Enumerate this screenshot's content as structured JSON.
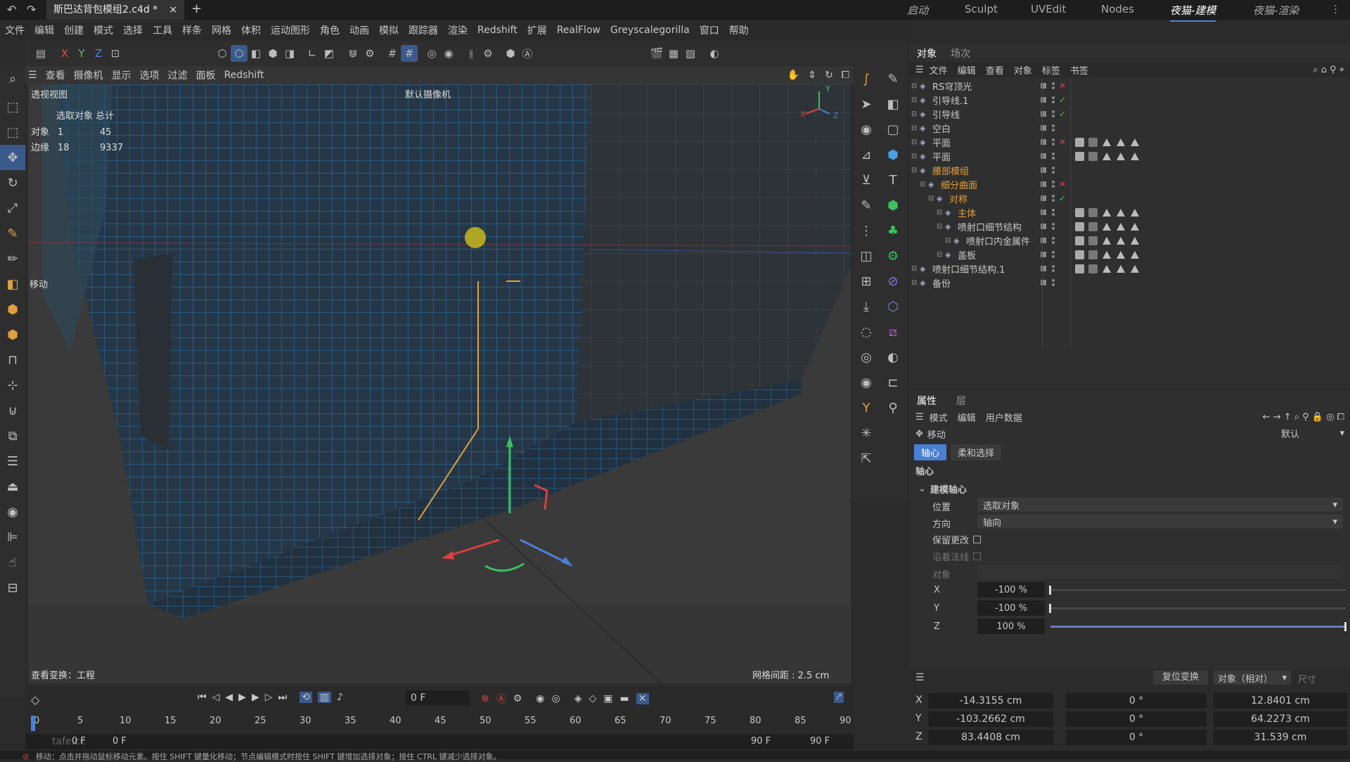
{
  "titlebar": {
    "file_tab": "斯巴达背包模组2.c4d *",
    "add_tab": "+"
  },
  "layouts": [
    "启动",
    "Sculpt",
    "UVEdit",
    "Nodes",
    "夜猫-建模",
    "夜猫-渲染"
  ],
  "menu": [
    "文件",
    "编辑",
    "创建",
    "模式",
    "选择",
    "工具",
    "样条",
    "网格",
    "体积",
    "运动图形",
    "角色",
    "动画",
    "模拟",
    "跟踪器",
    "渲染",
    "Redshift",
    "扩展",
    "RealFlow",
    "Greyscalegorilla",
    "窗口",
    "帮助"
  ],
  "toolbar_axes": [
    "X",
    "Y",
    "Z"
  ],
  "viewport": {
    "menu": [
      "查看",
      "摄像机",
      "显示",
      "选项",
      "过滤",
      "面板",
      "Redshift"
    ],
    "view_name": "透视视图",
    "camera": "默认摄像机",
    "hud_header": "选取对象 总计",
    "hud_rows": [
      {
        "label": "对象",
        "a": "1",
        "b": "45"
      },
      {
        "label": "边缘",
        "a": "18",
        "b": "9337"
      }
    ],
    "move_label": "移动",
    "view_transform": "查看变换：工程",
    "grid_spacing": "网格间距 : 2.5 cm",
    "axis_labels": {
      "y": "Y",
      "x": "X",
      "z": "Z"
    }
  },
  "timeline": {
    "current": "0 F",
    "ticks": [
      "0",
      "5",
      "10",
      "15",
      "20",
      "25",
      "30",
      "35",
      "40",
      "45",
      "50",
      "55",
      "60",
      "65",
      "70",
      "75",
      "80",
      "85",
      "90"
    ],
    "start": "0 F",
    "start2": "0 F",
    "end": "90 F",
    "end2": "90 F",
    "logo": "tafe.cc"
  },
  "status": "移动：点击并拖动鼠标移动元素。按住 SHIFT 键量化移动；节点编辑模式时按住 SHIFT 键增加选择对象；按住 CTRL 键减少选择对象。",
  "object_panel": {
    "tabs": [
      "对象",
      "场次"
    ],
    "menu": [
      "文件",
      "编辑",
      "查看",
      "对象",
      "标签",
      "书签"
    ],
    "rows": [
      {
        "name": "RS穹顶光",
        "indent": 0,
        "status": "x",
        "color": "#c8c8c8"
      },
      {
        "name": "引导线.1",
        "indent": 0,
        "status": "check",
        "color": "#c8c8c8"
      },
      {
        "name": "引导线",
        "indent": 0,
        "status": "check",
        "color": "#c8c8c8"
      },
      {
        "name": "空白",
        "indent": 0,
        "status": "",
        "color": "#c8c8c8"
      },
      {
        "name": "平面",
        "indent": 0,
        "status": "x",
        "color": "#c8c8c8"
      },
      {
        "name": "平面",
        "indent": 0,
        "status": "",
        "color": "#c8c8c8"
      },
      {
        "name": "腰部模组",
        "indent": 0,
        "status": "",
        "color": "#e0a040"
      },
      {
        "name": "细分曲面",
        "indent": 1,
        "status": "x",
        "color": "#e0a040"
      },
      {
        "name": "对称",
        "indent": 2,
        "status": "check",
        "color": "#e0a040"
      },
      {
        "name": "主体",
        "indent": 3,
        "status": "",
        "color": "#e0a040"
      },
      {
        "name": "喷射口细节结构",
        "indent": 3,
        "status": "",
        "color": "#c8c8c8"
      },
      {
        "name": "喷射口内金属件",
        "indent": 4,
        "status": "",
        "color": "#c8c8c8"
      },
      {
        "name": "盖板",
        "indent": 3,
        "status": "",
        "color": "#c8c8c8"
      },
      {
        "name": "喷射口细节结构.1",
        "indent": 0,
        "status": "",
        "color": "#c8c8c8"
      },
      {
        "name": "备份",
        "indent": 0,
        "status": "",
        "color": "#c8c8c8"
      }
    ]
  },
  "attr_panel": {
    "tabs": [
      "属性",
      "层"
    ],
    "menu": [
      "模式",
      "编辑",
      "用户数据"
    ],
    "tool": "移动",
    "preset": "默认",
    "subtabs": [
      "轴心",
      "柔和选择"
    ],
    "section": "轴心",
    "group": "建模轴心",
    "position_label": "位置",
    "position_value": "选取对象",
    "direction_label": "方向",
    "direction_value": "轴向",
    "keep_changes": "保留更改",
    "along_normal": "沿着法线",
    "object_label": "对象",
    "xyz": [
      {
        "axis": "X",
        "value": "-100 %",
        "fill": 0.0
      },
      {
        "axis": "Y",
        "value": "-100 %",
        "fill": 0.0
      },
      {
        "axis": "Z",
        "value": "100 %",
        "fill": 1.0
      }
    ]
  },
  "coords": {
    "reset_btn": "复位变换",
    "mode": "对象（相对）",
    "size_label": "尺寸",
    "rows": [
      {
        "axis": "X",
        "pos": "-14.3155 cm",
        "rot": "0 °",
        "size": "12.8401 cm"
      },
      {
        "axis": "Y",
        "pos": "-103.2662 cm",
        "rot": "0 °",
        "size": "64.2273 cm"
      },
      {
        "axis": "Z",
        "pos": "83.4408 cm",
        "rot": "0 °",
        "size": "31.539 cm"
      }
    ]
  },
  "colors": {
    "accent": "#4a7fd4",
    "mesh": "#2f86c4",
    "orange": "#e0a040",
    "red": "#d94040",
    "green": "#3cc060"
  }
}
